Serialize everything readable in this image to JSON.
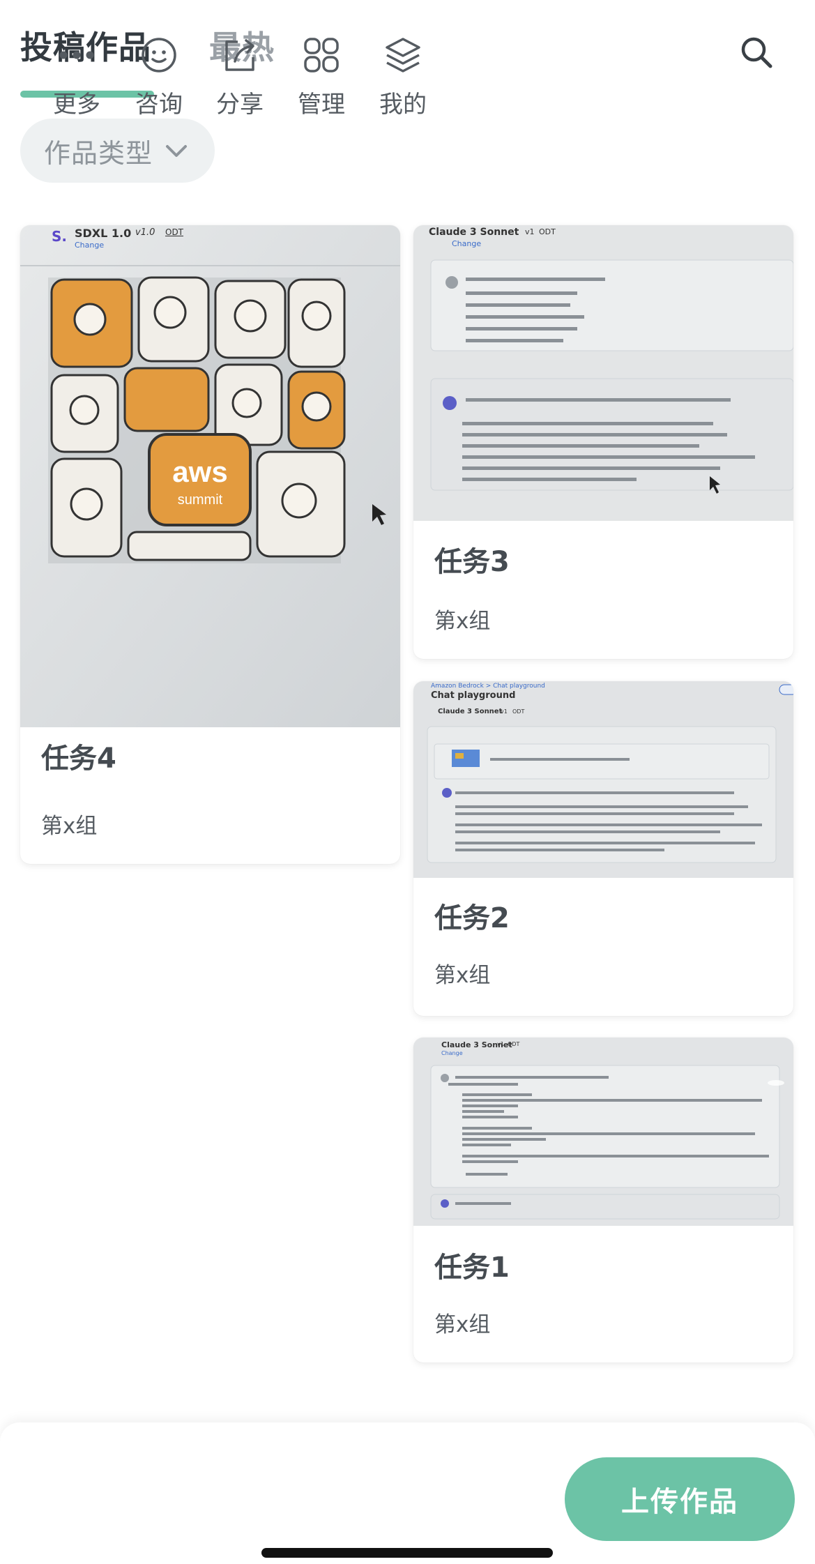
{
  "header": {
    "tabs": [
      {
        "label": "投稿作品",
        "active": true
      },
      {
        "label": "最热",
        "active": false
      }
    ],
    "search_icon": "search-icon"
  },
  "filter": {
    "label": "作品类型",
    "icon": "chevron-down-icon"
  },
  "cards": {
    "task4": {
      "title": "任务4",
      "subtitle": "第x组",
      "thumb": {
        "app": "SDXL 1.0",
        "version": "v1.0",
        "tag": "ODT",
        "link": "Change",
        "logo_text": "aws",
        "logo_sub": "summit"
      }
    },
    "task3": {
      "title": "任务3",
      "subtitle": "第x组",
      "thumb": {
        "app": "Claude 3 Sonnet",
        "version": "v1",
        "tag": "ODT",
        "link": "Change"
      }
    },
    "task2": {
      "title": "任务2",
      "subtitle": "第x组",
      "thumb": {
        "crumb": "Amazon Bedrock > Chat playground",
        "page_title": "Chat playground",
        "app": "Claude 3 Sonnet",
        "version": "v1",
        "tag": "ODT"
      }
    },
    "task1": {
      "title": "任务1",
      "subtitle": "第x组",
      "thumb": {
        "app": "Claude 3 Sonnet",
        "version": "v1",
        "tag": "ODT",
        "link": "Change"
      }
    }
  },
  "bottom_nav": {
    "items": [
      {
        "label": "更多",
        "icon": "more-icon"
      },
      {
        "label": "咨询",
        "icon": "smile-icon"
      },
      {
        "label": "分享",
        "icon": "share-icon"
      },
      {
        "label": "管理",
        "icon": "grid-icon"
      },
      {
        "label": "我的",
        "icon": "layers-icon"
      }
    ],
    "upload_label": "上传作品"
  },
  "colors": {
    "accent": "#6cc3a6",
    "text_dark": "#333a40",
    "text_muted": "#9aa0a6"
  }
}
